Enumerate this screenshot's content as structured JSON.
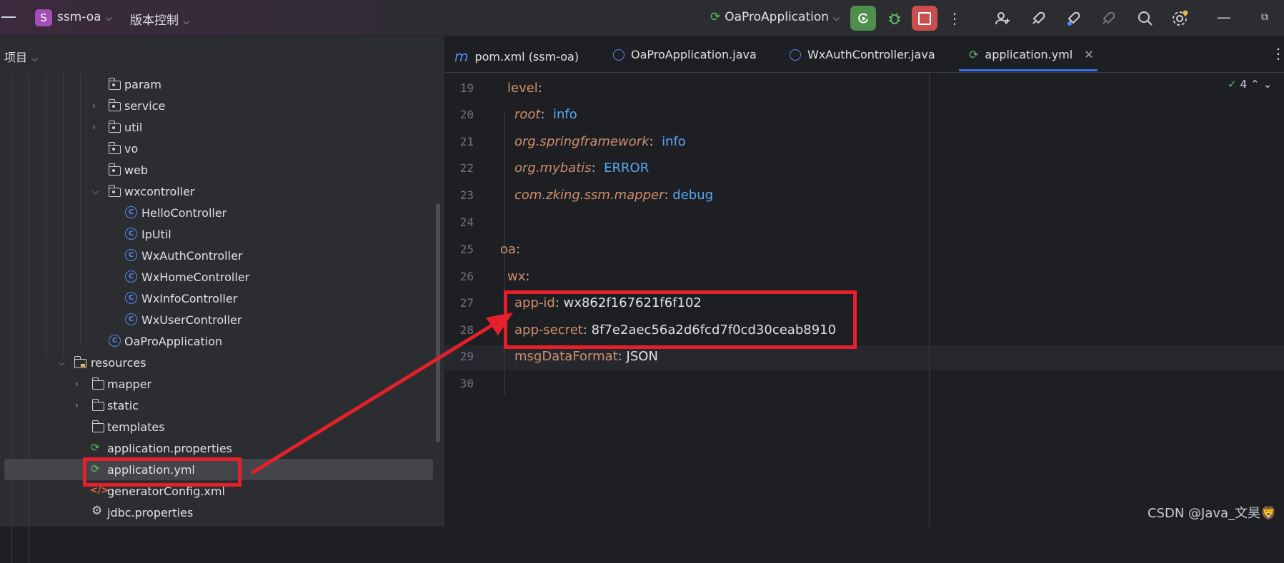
{
  "titlebar": {
    "project_initial": "S",
    "project_name": "ssm-oa",
    "vcs_label": "版本控制",
    "run_config": "OaProApplication"
  },
  "sidebar": {
    "header": "项目",
    "items": [
      {
        "label": "param"
      },
      {
        "label": "service"
      },
      {
        "label": "util"
      },
      {
        "label": "vo"
      },
      {
        "label": "web"
      },
      {
        "label": "wxcontroller"
      },
      {
        "label": "HelloController"
      },
      {
        "label": "IpUtil"
      },
      {
        "label": "WxAuthController"
      },
      {
        "label": "WxHomeController"
      },
      {
        "label": "WxInfoController"
      },
      {
        "label": "WxUserController"
      },
      {
        "label": "OaProApplication"
      },
      {
        "label": "resources"
      },
      {
        "label": "mapper"
      },
      {
        "label": "static"
      },
      {
        "label": "templates"
      },
      {
        "label": "application.properties"
      },
      {
        "label": "application.yml"
      },
      {
        "label": "generatorConfig.xml"
      },
      {
        "label": "jdbc.properties"
      }
    ]
  },
  "tabs": [
    {
      "label": "pom.xml (ssm-oa)"
    },
    {
      "label": "OaProApplication.java"
    },
    {
      "label": "WxAuthController.java"
    },
    {
      "label": "application.yml"
    }
  ],
  "editor": {
    "inspection_count": "4",
    "lines": [
      {
        "num": "19",
        "key": "level",
        "value": ""
      },
      {
        "num": "20",
        "key": "root",
        "value": "info"
      },
      {
        "num": "21",
        "key": "org.springframework",
        "value": "info"
      },
      {
        "num": "22",
        "key": "org.mybatis",
        "value": "ERROR"
      },
      {
        "num": "23",
        "key": "com.zking.ssm.mapper",
        "value": "debug"
      },
      {
        "num": "24",
        "key": "",
        "value": ""
      },
      {
        "num": "25",
        "key": "oa",
        "value": ""
      },
      {
        "num": "26",
        "key": "wx",
        "value": ""
      },
      {
        "num": "27",
        "key": "app-id",
        "value": "wx862f167621f6f102"
      },
      {
        "num": "28",
        "key": "app-secret",
        "value": "8f7e2aec56a2d6fcd7f0cd30ceab8910"
      },
      {
        "num": "29",
        "key": "msgDataFormat",
        "value": "JSON"
      },
      {
        "num": "30",
        "key": "",
        "value": ""
      }
    ]
  },
  "watermark": "CSDN @Java_文昊🦁",
  "colors": {
    "highlight": "#e5202a",
    "accent": "#3574f0"
  }
}
